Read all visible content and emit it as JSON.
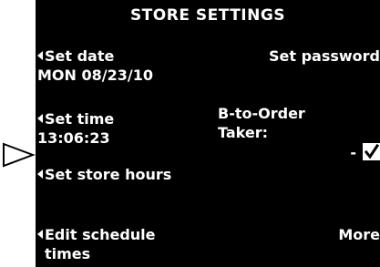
{
  "screen": {
    "title": "STORE SETTINGS",
    "left_items": [
      {
        "label": "Set date",
        "value": "MON 08/23/10"
      },
      {
        "label": "Set time",
        "value": "13:06:23"
      },
      {
        "label": "Set store hours"
      },
      {
        "label": "Edit schedule",
        "label_line2": "times"
      }
    ],
    "right_items": {
      "password_label": "Set password",
      "b_to_order_label_line1": "B-to-Order",
      "b_to_order_label_line2": "Taker:",
      "b_to_order_dash": "-",
      "b_to_order_checked": true,
      "more_label": "More"
    }
  },
  "pointer": {
    "icon": "hollow-right-triangle",
    "target": "Set store hours"
  }
}
